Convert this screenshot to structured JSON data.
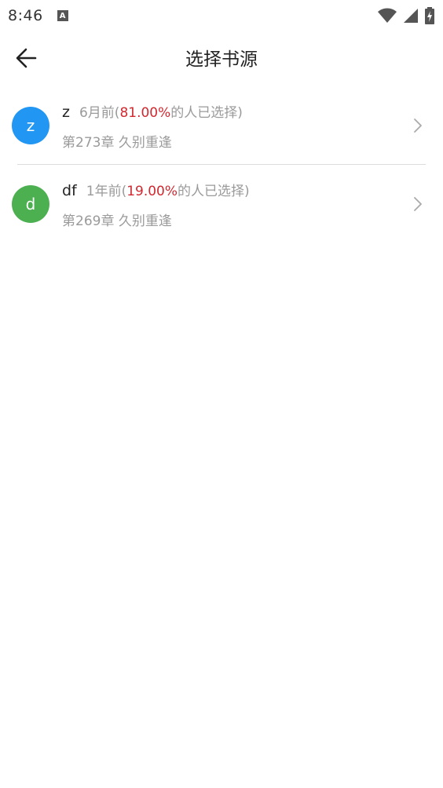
{
  "status_bar": {
    "time": "8:46",
    "notification_icon": "a-icon",
    "icons": [
      "wifi-icon",
      "signal-icon",
      "battery-icon"
    ]
  },
  "app_bar": {
    "back_icon": "arrow-left-icon",
    "title": "选择书源"
  },
  "sources": [
    {
      "avatar_letter": "z",
      "avatar_color": "#2196F3",
      "name": "z",
      "time_ago": "6月前(",
      "percent": "81.00%",
      "suffix": "的人已选择)",
      "chapter": "第273章 久别重逢"
    },
    {
      "avatar_letter": "d",
      "avatar_color": "#4CAF50",
      "name": "df",
      "time_ago": "1年前(",
      "percent": "19.00%",
      "suffix": "的人已选择)",
      "chapter": "第269章 久别重逢"
    }
  ],
  "colors": {
    "percent_red": "#d0282f",
    "secondary_text": "#9a9a9a"
  }
}
